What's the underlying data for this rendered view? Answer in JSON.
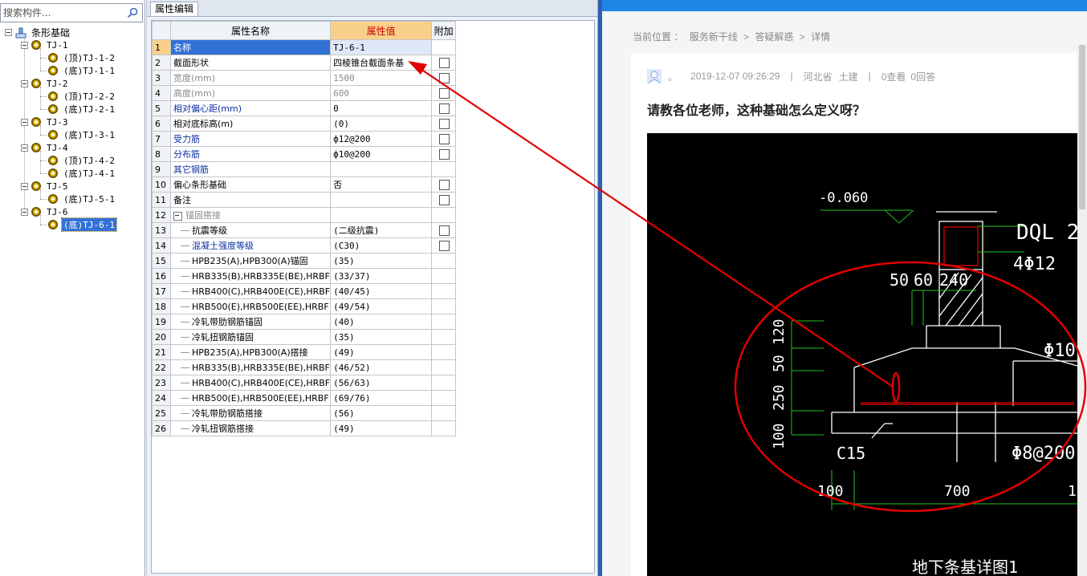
{
  "search": {
    "placeholder": "搜索构件..."
  },
  "tree": {
    "root": "条形基础",
    "groups": [
      {
        "label": "TJ-1",
        "children": [
          "(顶)TJ-1-2",
          "(底)TJ-1-1"
        ]
      },
      {
        "label": "TJ-2",
        "children": [
          "(顶)TJ-2-2",
          "(底)TJ-2-1"
        ]
      },
      {
        "label": "TJ-3",
        "children": [
          "(底)TJ-3-1"
        ]
      },
      {
        "label": "TJ-4",
        "children": [
          "(顶)TJ-4-2",
          "(底)TJ-4-1"
        ]
      },
      {
        "label": "TJ-5",
        "children": [
          "(底)TJ-5-1"
        ]
      },
      {
        "label": "TJ-6",
        "children": [
          "(底)TJ-6-1"
        ]
      }
    ],
    "selected": "(底)TJ-6-1"
  },
  "editor": {
    "tab": "属性编辑",
    "headers": {
      "name": "属性名称",
      "value": "属性值",
      "extra": "附加"
    },
    "rows": [
      {
        "no": "1",
        "name": "名称",
        "value": "TJ-6-1",
        "check": false,
        "style": "blue"
      },
      {
        "no": "2",
        "name": "截面形状",
        "value": "四棱锥台截面条基",
        "check": true,
        "style": ""
      },
      {
        "no": "3",
        "name": "宽度(mm)",
        "value": "1500",
        "check": true,
        "style": "gray"
      },
      {
        "no": "4",
        "name": "高度(mm)",
        "value": "600",
        "check": true,
        "style": "gray"
      },
      {
        "no": "5",
        "name": "相对偏心距(mm)",
        "value": "0",
        "check": true,
        "style": "blue"
      },
      {
        "no": "6",
        "name": "相对底标高(m)",
        "value": "(0)",
        "check": true,
        "style": ""
      },
      {
        "no": "7",
        "name": "受力筋",
        "value": "ф12@200",
        "check": true,
        "style": "blue"
      },
      {
        "no": "8",
        "name": "分布筋",
        "value": "ф10@200",
        "check": true,
        "style": "blue"
      },
      {
        "no": "9",
        "name": "其它钢筋",
        "value": "",
        "check": false,
        "style": "blue"
      },
      {
        "no": "10",
        "name": "偏心条形基础",
        "value": "否",
        "check": true,
        "style": ""
      },
      {
        "no": "11",
        "name": "备注",
        "value": "",
        "check": true,
        "style": ""
      },
      {
        "no": "12",
        "name": "锚固搭接",
        "value": "",
        "check": false,
        "style": "gray",
        "group": true
      },
      {
        "no": "13",
        "name": "抗震等级",
        "value": "(二级抗震)",
        "check": true,
        "style": "",
        "sub": true
      },
      {
        "no": "14",
        "name": "混凝土强度等级",
        "value": "(C30)",
        "check": true,
        "style": "blue",
        "sub": true
      },
      {
        "no": "15",
        "name": "HPB235(A),HPB300(A)锚固",
        "value": "(35)",
        "check": false,
        "style": "",
        "sub": true
      },
      {
        "no": "16",
        "name": "HRB335(B),HRB335E(BE),HRBF",
        "value": "(33/37)",
        "check": false,
        "style": "",
        "sub": true
      },
      {
        "no": "17",
        "name": "HRB400(C),HRB400E(CE),HRBF",
        "value": "(40/45)",
        "check": false,
        "style": "",
        "sub": true
      },
      {
        "no": "18",
        "name": "HRB500(E),HRB500E(EE),HRBF",
        "value": "(49/54)",
        "check": false,
        "style": "",
        "sub": true
      },
      {
        "no": "19",
        "name": "冷轧带肋钢筋锚固",
        "value": "(40)",
        "check": false,
        "style": "",
        "sub": true
      },
      {
        "no": "20",
        "name": "冷轧扭钢筋锚固",
        "value": "(35)",
        "check": false,
        "style": "",
        "sub": true
      },
      {
        "no": "21",
        "name": "HPB235(A),HPB300(A)搭接",
        "value": "(49)",
        "check": false,
        "style": "",
        "sub": true
      },
      {
        "no": "22",
        "name": "HRB335(B),HRB335E(BE),HRBF",
        "value": "(46/52)",
        "check": false,
        "style": "",
        "sub": true
      },
      {
        "no": "23",
        "name": "HRB400(C),HRB400E(CE),HRBF",
        "value": "(56/63)",
        "check": false,
        "style": "",
        "sub": true
      },
      {
        "no": "24",
        "name": "HRB500(E),HRB500E(EE),HRBF",
        "value": "(69/76)",
        "check": false,
        "style": "",
        "sub": true
      },
      {
        "no": "25",
        "name": "冷轧带肋钢筋搭接",
        "value": "(56)",
        "check": false,
        "style": "",
        "sub": true
      },
      {
        "no": "26",
        "name": "冷轧扭钢筋搭接",
        "value": "(49)",
        "check": false,
        "style": "",
        "sub": true
      }
    ]
  },
  "webpage": {
    "breadcrumb": [
      "当前位置 ：",
      "服务新干线",
      ">",
      "答疑解惑",
      ">",
      "详情"
    ],
    "meta": {
      "user": "。",
      "datetime": "2019-12-07 09:26:29",
      "sep": "|",
      "region": "河北省",
      "specialty": "土建",
      "views": "0查看",
      "answers": "0回答"
    },
    "title": "请教各位老师，这种基础怎么定义呀？",
    "drawing": {
      "labels": [
        "-0.060",
        "DQL 2",
        "4Φ12",
        "50",
        "60",
        "240",
        "120",
        "50",
        "250",
        "100",
        "Φ10",
        "C15",
        "Φ8@200",
        "100",
        "700",
        "1",
        "地下条基详图1"
      ],
      "line_color": "#ffffff",
      "dim_color": "#22c222",
      "annotation_color": "#e00000"
    }
  },
  "colors": {
    "selection": "#3271d6",
    "header_value_bg": "#f8d08a",
    "accent_blue": "#1f86e8"
  }
}
